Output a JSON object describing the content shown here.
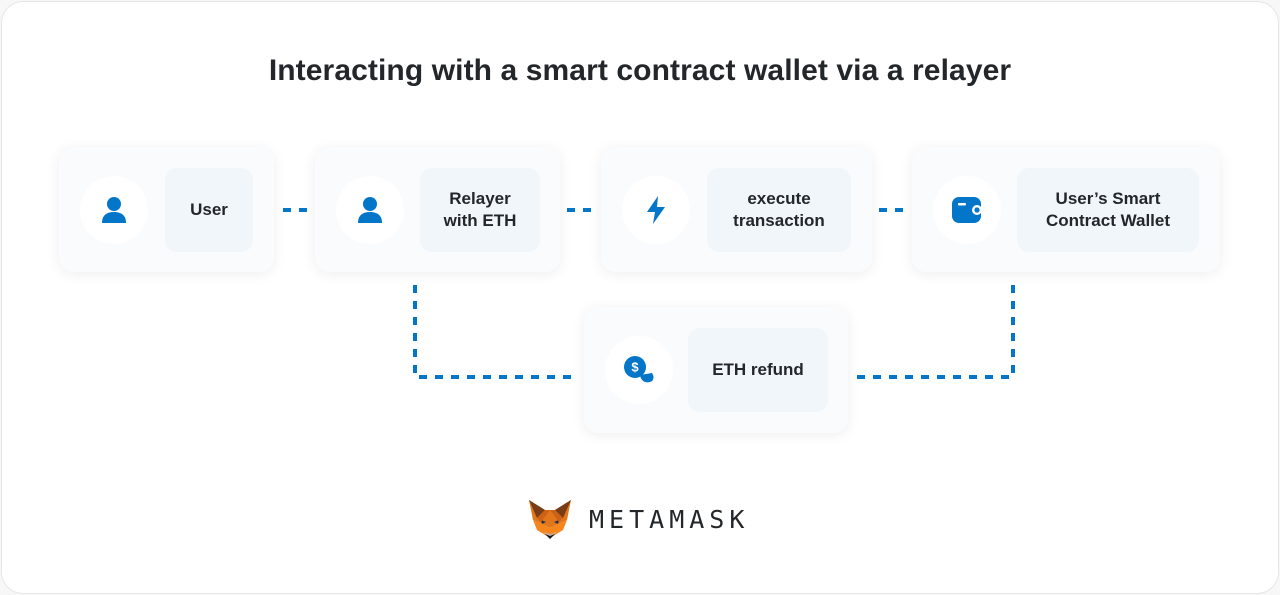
{
  "title": "Interacting with a smart contract wallet via a relayer",
  "colors": {
    "accent": "#0376c9",
    "text": "#24272a",
    "label_bg": "#f1f6fb",
    "card_bg": "#fafbfc"
  },
  "nodes": [
    {
      "id": "user",
      "icon": "user-icon",
      "label": "User"
    },
    {
      "id": "relayer",
      "icon": "user-icon",
      "label": "Relayer\nwith ETH"
    },
    {
      "id": "execute",
      "icon": "lightning-icon",
      "label": "execute\ntransaction"
    },
    {
      "id": "wallet",
      "icon": "wallet-icon",
      "label": "User’s Smart\nContract Wallet"
    },
    {
      "id": "refund",
      "icon": "coins-icon",
      "label": "ETH refund"
    }
  ],
  "edges": [
    {
      "from": "user",
      "to": "relayer"
    },
    {
      "from": "relayer",
      "to": "execute"
    },
    {
      "from": "execute",
      "to": "wallet"
    },
    {
      "from": "relayer",
      "to": "refund"
    },
    {
      "from": "wallet",
      "to": "refund"
    }
  ],
  "brand": {
    "name": "METAMASK",
    "logo": "metamask-fox-icon"
  }
}
